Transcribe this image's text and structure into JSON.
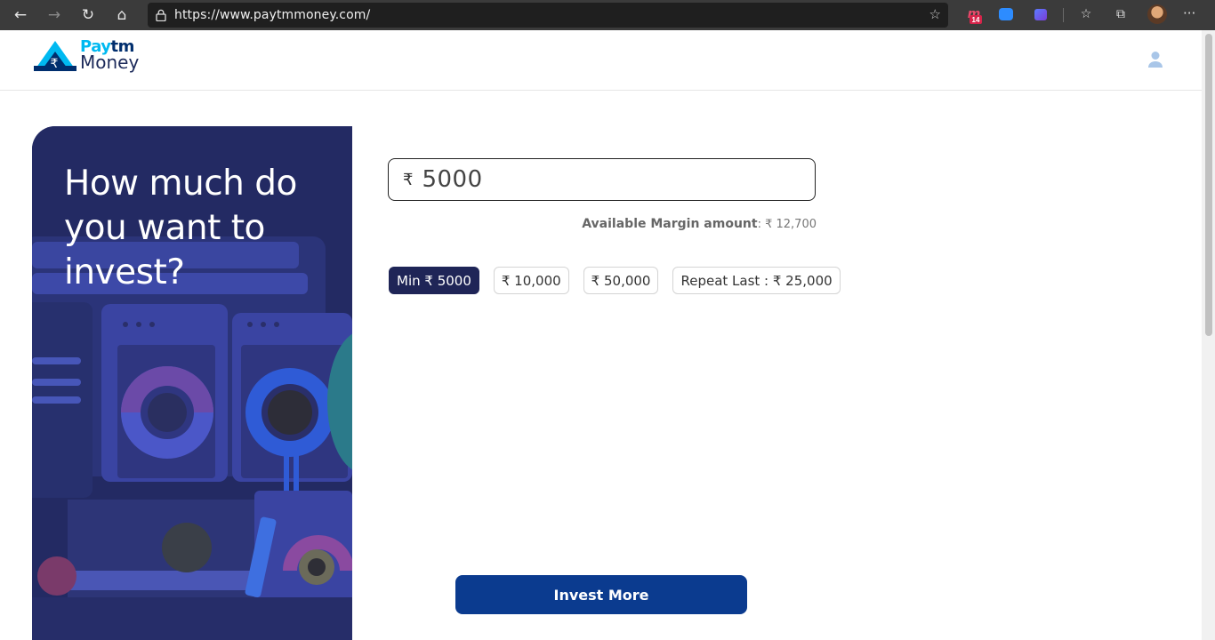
{
  "browser": {
    "url": "https://www.paytmmoney.com/",
    "back_icon": "←",
    "forward_icon": "→",
    "refresh_icon": "↻",
    "home_icon": "⌂",
    "lock_icon": "🔒",
    "star_icon": "☆",
    "extension_badge": "14",
    "favorites_icon": "☆",
    "collections_icon": "⧉",
    "more_icon": "···"
  },
  "site": {
    "logo_paytm_a": "Pay",
    "logo_paytm_b": "tm",
    "logo_money": "Money",
    "rupee_symbol": "₹"
  },
  "hero": {
    "title": "How much do you want to invest?"
  },
  "form": {
    "currency_symbol": "₹",
    "amount_value": "5000",
    "margin_label": "Available Margin amount",
    "margin_value": ": ₹ 12,700",
    "chips": [
      {
        "label": "Min ₹ 5000",
        "active": true
      },
      {
        "label": "₹ 10,000",
        "active": false
      },
      {
        "label": "₹ 50,000",
        "active": false
      },
      {
        "label": "Repeat Last  : ₹ 25,000",
        "active": false
      }
    ],
    "invest_button": "Invest More"
  },
  "colors": {
    "hero_bg": "#232a63",
    "chip_active": "#1f2557",
    "button": "#0b3b8f",
    "logo_light": "#00b9f1",
    "logo_dark": "#002e6e"
  }
}
